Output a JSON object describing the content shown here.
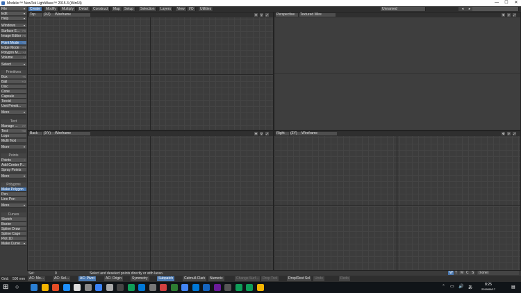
{
  "window": {
    "title": "Modeler™ NewTek LightWave™ 2015.3 (Win64)",
    "controls": [
      "—",
      "☐",
      "✕"
    ]
  },
  "menu_tabs": [
    "Create",
    "Modify",
    "Multiply",
    "Detail",
    "Construct",
    "Map",
    "Setup",
    "Selection",
    "Layers",
    "View",
    "I/O",
    "Utilities"
  ],
  "active_tab": "Create",
  "object_name": "Unnamed",
  "left_panel": {
    "top_menus": [
      "File",
      "Edit",
      "Help"
    ],
    "windows": "Windows",
    "surface_editor": {
      "label": "Surface E...",
      "shortcut": "F5"
    },
    "image_editor": {
      "label": "Image Editor",
      "shortcut": "F6"
    },
    "modes": [
      {
        "label": "Point Mode",
        "shortcut": "^G",
        "selected": true
      },
      {
        "label": "Edge Mode",
        "shortcut": "^H"
      },
      {
        "label": "Polygon M...",
        "shortcut": "^J"
      },
      {
        "label": "Volume",
        "shortcut": "^J"
      }
    ],
    "select": "Select",
    "primitives": {
      "header": "Primitives",
      "items": [
        {
          "label": "Box",
          "shortcut": "+X"
        },
        {
          "label": "Ball",
          "shortcut": "+O"
        },
        {
          "label": "Disc"
        },
        {
          "label": "Cone"
        },
        {
          "label": "Capsule"
        },
        {
          "label": "Toroid"
        },
        {
          "label": "Unit Primiti..."
        }
      ],
      "more": "More"
    },
    "text": {
      "header": "Text",
      "items": [
        {
          "label": "Manage ...",
          "shortcut": "F7"
        },
        {
          "label": "Text",
          "shortcut": "+W"
        },
        {
          "label": "Logo"
        },
        {
          "label": "Multi Text"
        }
      ],
      "more": "More"
    },
    "points": {
      "header": "Points",
      "items": [
        {
          "label": "Points",
          "shortcut": "+"
        },
        {
          "label": "Add Center P..."
        },
        {
          "label": "Spray Points"
        }
      ],
      "more": "More"
    },
    "polygons": {
      "header": "Polygons",
      "items": [
        {
          "label": "Make Polygon",
          "selected": true
        },
        {
          "label": "Pen"
        },
        {
          "label": "Line Pen"
        }
      ],
      "more": "More"
    },
    "curves": {
      "header": "Curves",
      "items": [
        {
          "label": "Sketch"
        },
        {
          "label": "Bezier"
        },
        {
          "label": "Spline Draw"
        },
        {
          "label": "Spline Cage"
        },
        {
          "label": "Plot 1D"
        },
        {
          "label": "Make Curve"
        }
      ]
    }
  },
  "viewports": [
    {
      "view": "Top",
      "axes": "(XZ)",
      "mode": "Wireframe"
    },
    {
      "view": "Perspective",
      "axes": "",
      "mode": "Textured Wire"
    },
    {
      "view": "Back",
      "axes": "(XY)",
      "mode": "Wireframe"
    },
    {
      "view": "Right",
      "axes": "(ZY)",
      "mode": "Wireframe"
    }
  ],
  "status": {
    "label": "Sel:",
    "count": "0",
    "hint": "Select and deselect points directly or with lasso.",
    "layers": [
      "W",
      "T",
      "M",
      "C",
      "S"
    ],
    "active_layer": "W",
    "vmap": "(none)"
  },
  "bottom_bar": {
    "grid_label": "Grid:",
    "grid_value": "500 mm",
    "items": [
      {
        "label": "AC: Mo...",
        "sel": false
      },
      {
        "label": "AC: Sel...",
        "sel": false
      },
      {
        "label": "AC: Pivot",
        "sel": true
      },
      {
        "label": "AC: Origin",
        "sel": false
      },
      {
        "label": "Symmetry",
        "sel": false
      },
      {
        "label": "Subpatch",
        "sel": true
      },
      {
        "label": "Catmull-Clark",
        "sel": false
      },
      {
        "label": "Numeric",
        "sel": false
      },
      {
        "label": "Change Surf...",
        "dim": true
      },
      {
        "label": "Drop Tool",
        "dim": true
      },
      {
        "label": "Drop/Rest Sel",
        "sel": false
      },
      {
        "label": "Undo",
        "dim": true
      },
      {
        "label": "Redo",
        "dim": true
      }
    ]
  },
  "taskbar": {
    "time": "8:25",
    "date": "2019/06/17",
    "icon_colors": [
      "#2a7fd4",
      "#f4b400",
      "#e44d26",
      "#1e90ff",
      "#ddd",
      "#888",
      "#3b82f6",
      "#aaa",
      "#444",
      "#0f9d58",
      "#0078d7",
      "#777",
      "#d04040",
      "#2e7d32",
      "#4285f4",
      "#0078d7",
      "#1565c0",
      "#6a1b9a",
      "#555",
      "#0f9d58",
      "#0f9d58",
      "#f4b400"
    ]
  }
}
